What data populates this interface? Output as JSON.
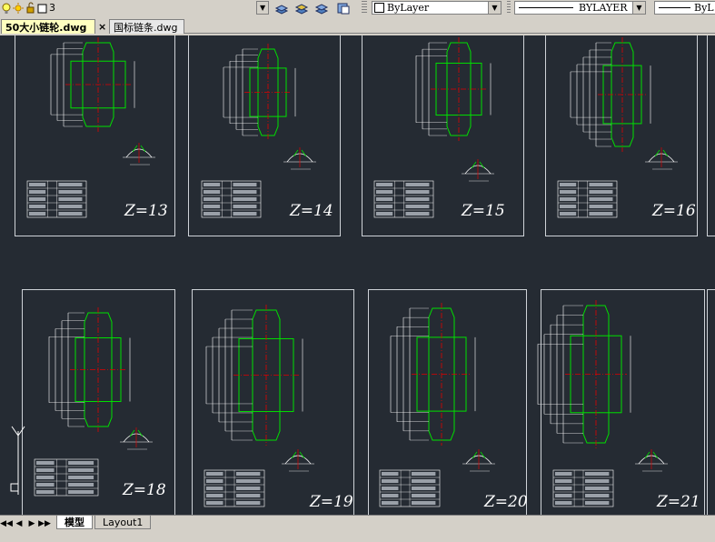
{
  "toolbar": {
    "layer_value": "3",
    "color_combo": "ByLayer",
    "linetype_combo": "BYLAYER",
    "lineweight_combo": "ByL"
  },
  "tabs": [
    {
      "label": "50大小链轮.dwg",
      "active": true
    },
    {
      "label": "国标链条.dwg",
      "active": false
    }
  ],
  "sheets_row1": [
    {
      "z_label": "Z=13"
    },
    {
      "z_label": "Z=14"
    },
    {
      "z_label": "Z=15"
    },
    {
      "z_label": "Z=16"
    }
  ],
  "sheets_row2": [
    {
      "z_label": "Z=18"
    },
    {
      "z_label": "Z=19"
    },
    {
      "z_label": "Z=20"
    },
    {
      "z_label": "Z=21"
    }
  ],
  "layout_tabs": [
    {
      "label": "模型",
      "active": true
    },
    {
      "label": "Layout1",
      "active": false
    }
  ],
  "colors": {
    "canvas_bg": "#252b33",
    "gear_outline": "#00e000",
    "centerline": "#e00000",
    "annotation": "#ffffff"
  }
}
